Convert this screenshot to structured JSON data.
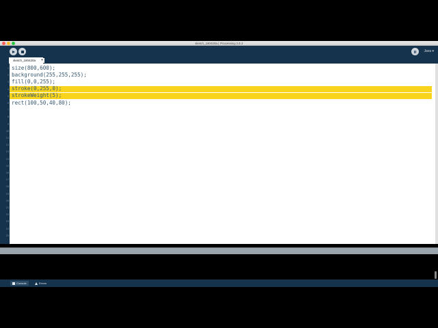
{
  "window": {
    "title": "sketch_180420a | Processing 3.0.2"
  },
  "toolbar": {
    "run_icon": "play-icon",
    "stop_icon": "stop-icon",
    "debug_icon": "debugger-icon",
    "mode_label": "Java ▾"
  },
  "tabs": {
    "active": "sketch_180420a",
    "menu_arrow": "▾"
  },
  "editor": {
    "lines": [
      "size(800,600);",
      "background(255,255,255);",
      "fill(0,0,255);",
      "stroke(0,255,0);",
      "strokeWeight(5);",
      "rect(100,50,40,80);"
    ],
    "line_numbers": [
      "1",
      "2",
      "3",
      "4",
      "5",
      "6",
      "7",
      "8",
      "9",
      "10",
      "11",
      "12",
      "13",
      "14",
      "15",
      "16",
      "17",
      "18",
      "19",
      "20",
      "21",
      "22",
      "23",
      "24",
      "25"
    ],
    "highlight_color": "#f8d41c"
  },
  "footer": {
    "console_label": "Console",
    "errors_label": "Errors"
  }
}
